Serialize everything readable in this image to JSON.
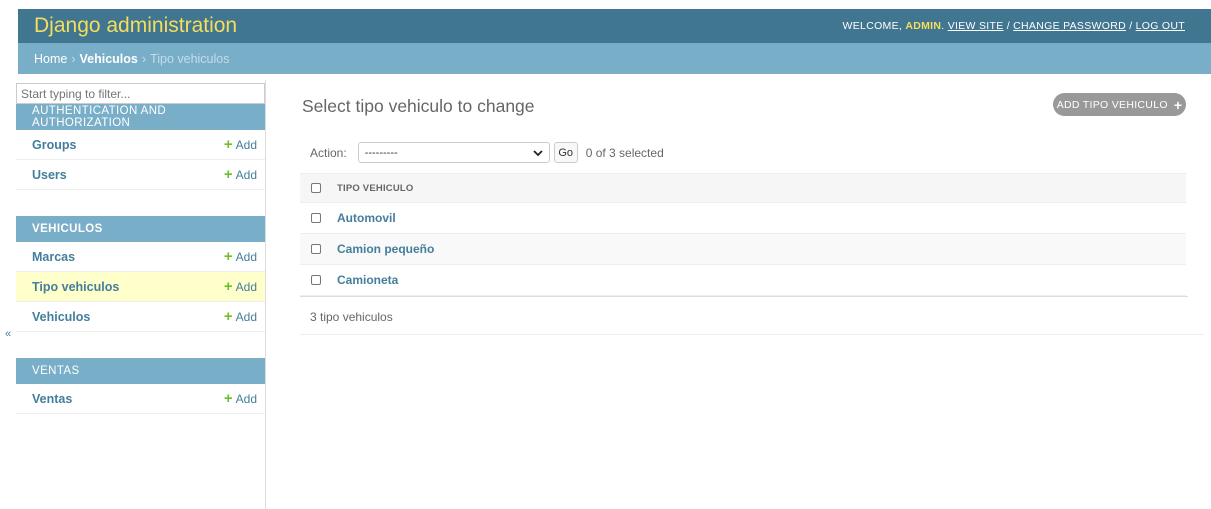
{
  "header": {
    "branding": "Django administration",
    "welcome": "WELCOME,",
    "username": "ADMIN",
    "view_site": "VIEW SITE",
    "change_password": "CHANGE PASSWORD",
    "log_out": "LOG OUT",
    "separator": "/"
  },
  "breadcrumbs": {
    "home": "Home",
    "app": "Vehiculos",
    "current": "Tipo vehiculos",
    "separator": "›"
  },
  "sidebar": {
    "filter_placeholder": "Start typing to filter...",
    "toggle": "«",
    "modules": [
      {
        "caption": "AUTHENTICATION AND AUTHORIZATION",
        "models": [
          {
            "name": "Groups",
            "add": "Add"
          },
          {
            "name": "Users",
            "add": "Add"
          }
        ]
      },
      {
        "caption": "VEHICULOS",
        "models": [
          {
            "name": "Marcas",
            "add": "Add"
          },
          {
            "name": "Tipo vehiculos",
            "add": "Add"
          },
          {
            "name": "Vehiculos",
            "add": "Add"
          }
        ]
      },
      {
        "caption": "VENTAS",
        "models": [
          {
            "name": "Ventas",
            "add": "Add"
          }
        ]
      }
    ]
  },
  "content": {
    "title": "Select tipo vehiculo to change",
    "add_button": "ADD TIPO VEHICULO",
    "action_label": "Action:",
    "action_selected": "---------",
    "go": "Go",
    "selected_count": "0 of 3 selected",
    "column_header": "TIPO VEHICULO",
    "rows": [
      "Automovil",
      "Camion pequeño",
      "Camioneta"
    ],
    "paginator": "3 tipo vehiculos"
  },
  "colors": {
    "header_bg": "#417690",
    "breadcrumb_bg": "#79aec8",
    "branding": "#f5dd5d",
    "link": "#447e9b",
    "add_plus": "#70bf2b",
    "current_row": "#ffffcc"
  },
  "icons": {
    "add": "plus-icon",
    "select": "chevron-down-icon",
    "toggle": "double-chevron-left-icon"
  }
}
